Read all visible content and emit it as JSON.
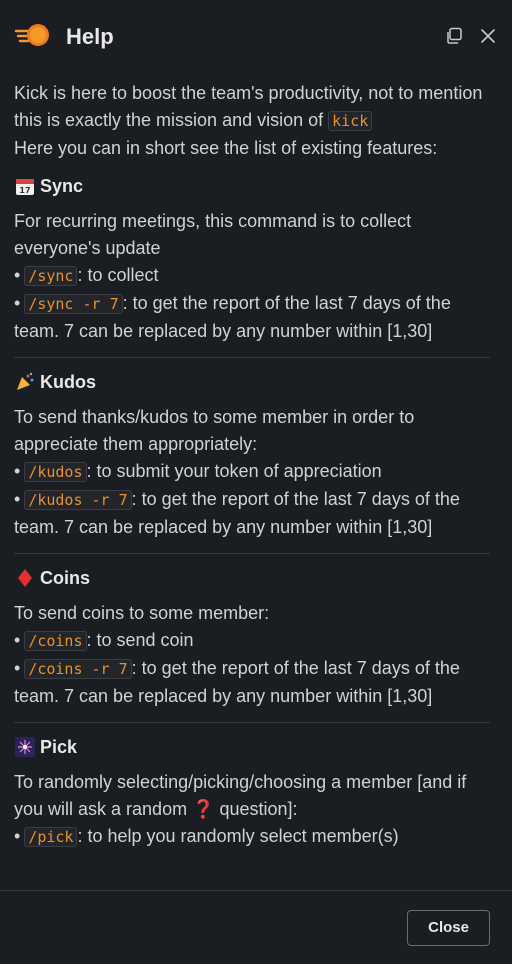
{
  "header": {
    "title": "Help"
  },
  "intro": {
    "line1": "Kick is here to boost the team's productivity, not to mention this is exactly the mission and vision of ",
    "code": "kick",
    "line2": "Here you can in short see the list of existing features:"
  },
  "sections": [
    {
      "title": "Sync",
      "icon": "calendar-icon",
      "description": "For recurring meetings, this command is to collect everyone's update",
      "items": [
        {
          "code": "/sync",
          "text": ": to collect"
        },
        {
          "code": "/sync -r 7",
          "text": ": to get the report of the last 7 days of the team. 7 can be replaced by any number within [1,30]"
        }
      ]
    },
    {
      "title": "Kudos",
      "icon": "party-popper-icon",
      "description": "To send thanks/kudos to some member in order to appreciate them appropriately:",
      "items": [
        {
          "code": "/kudos",
          "text": ": to submit your token of appreciation"
        },
        {
          "code": "/kudos -r 7",
          "text": ": to get the report of the last 7 days of the team. 7 can be replaced by any number within [1,30]"
        }
      ]
    },
    {
      "title": "Coins",
      "icon": "red-diamond-icon",
      "description": "To send coins to some member:",
      "items": [
        {
          "code": "/coins",
          "text": ": to send coin"
        },
        {
          "code": "/coins -r 7",
          "text": ": to get the report of the last 7 days of the team. 7 can be replaced by any number within [1,30]"
        }
      ]
    },
    {
      "title": "Pick",
      "icon": "sparkler-icon",
      "description_before": "To randomly selecting/picking/choosing a member [and if you will ask a random ",
      "description_after": " question]:",
      "items": [
        {
          "code": "/pick",
          "text": ": to help you randomly select member(s)"
        }
      ]
    }
  ],
  "footer": {
    "close_label": "Close"
  }
}
